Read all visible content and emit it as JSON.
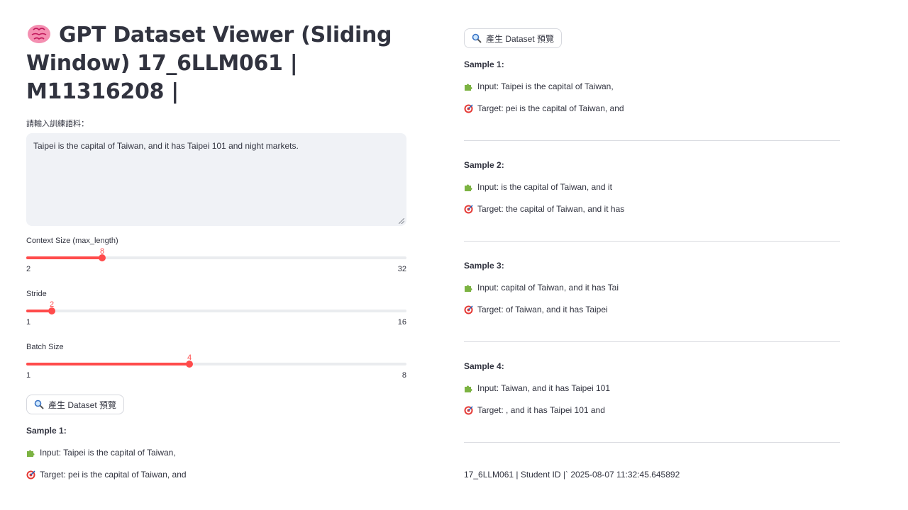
{
  "header": {
    "title": "GPT Dataset Viewer (Sliding Window) 17_6LLM061 | M11316208 |"
  },
  "text_input": {
    "label": "請輸入訓練語料：",
    "value": "Taipei is the capital of Taiwan, and it has Taipei 101 and night markets."
  },
  "sliders": {
    "context_size": {
      "label": "Context Size (max_length)",
      "value": "8",
      "min": "2",
      "max": "32",
      "level": 0.2
    },
    "stride": {
      "label": "Stride",
      "value": "2",
      "min": "1",
      "max": "16",
      "level": 0.0667
    },
    "batch_size": {
      "label": "Batch Size",
      "value": "4",
      "min": "1",
      "max": "8",
      "level": 0.4286
    }
  },
  "generate_button": {
    "label": "產生 Dataset 預覽"
  },
  "left_sample": {
    "title": "Sample 1:",
    "input": "Input: Taipei is the capital of Taiwan,",
    "target": "Target: pei is the capital of Taiwan, and"
  },
  "right_panel": {
    "button_label": "產生 Dataset 預覽",
    "samples": [
      {
        "title": "Sample 1:",
        "input": "Input: Taipei is the capital of Taiwan,",
        "target": "Target: pei is the capital of Taiwan, and"
      },
      {
        "title": "Sample 2:",
        "input": "Input: is the capital of Taiwan, and it",
        "target": "Target: the capital of Taiwan, and it has"
      },
      {
        "title": "Sample 3:",
        "input": "Input: capital of Taiwan, and it has Tai",
        "target": "Target: of Taiwan, and it has Taipei"
      },
      {
        "title": "Sample 4:",
        "input": "Input: Taiwan, and it has Taipei 101",
        "target": "Target: , and it has Taipei 101 and"
      }
    ],
    "footer": "17_6LLM061 | Student ID |` 2025-08-07 11:32:45.645892"
  },
  "colors": {
    "accent": "#ff4b4b",
    "input_bg": "#f0f2f6",
    "text": "#31333f"
  },
  "icons": {
    "title": "brain-icon",
    "button": "magnifier-icon",
    "input": "puzzle-icon",
    "target": "target-icon"
  }
}
